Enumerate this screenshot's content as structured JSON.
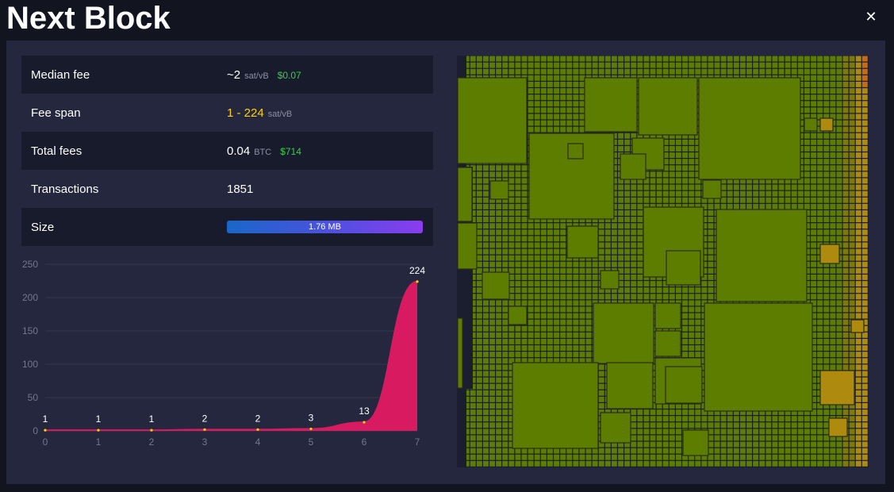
{
  "modal": {
    "title": "Next Block",
    "close_label": "✕"
  },
  "stats": {
    "median_fee": {
      "label": "Median fee",
      "value": "~2",
      "unit": "sat/vB",
      "fiat": "$0.07"
    },
    "fee_span": {
      "label": "Fee span",
      "value": "1 - 224",
      "unit": "sat/vB"
    },
    "total_fees": {
      "label": "Total fees",
      "value": "0.04",
      "unit": "BTC",
      "fiat": "$714"
    },
    "transactions": {
      "label": "Transactions",
      "value": "1851"
    },
    "size": {
      "label": "Size",
      "value": "1.76 MB",
      "fill_fraction": 1.0
    }
  },
  "chart_data": {
    "type": "area",
    "x": [
      0,
      1,
      2,
      3,
      4,
      5,
      6,
      7
    ],
    "y": [
      1,
      1,
      1,
      2,
      2,
      3,
      13,
      224
    ],
    "data_labels": [
      "1",
      "1",
      "1",
      "2",
      "2",
      "3",
      "13",
      "224"
    ],
    "xticks": [
      "0",
      "1",
      "2",
      "3",
      "4",
      "5",
      "6",
      "7"
    ],
    "yticks": [
      "0",
      "50",
      "100",
      "150",
      "200",
      "250"
    ],
    "ylim": [
      0,
      250
    ],
    "xlim": [
      0,
      7
    ],
    "grid": true,
    "fill_color": "#d81b60",
    "point_color": "#ffd200"
  },
  "treemap": {
    "base_color": "#5d7d01",
    "border_color": "#2a2d1a",
    "high_fee_color": "#ae8a0e",
    "edge_color": "#ca6a10"
  }
}
